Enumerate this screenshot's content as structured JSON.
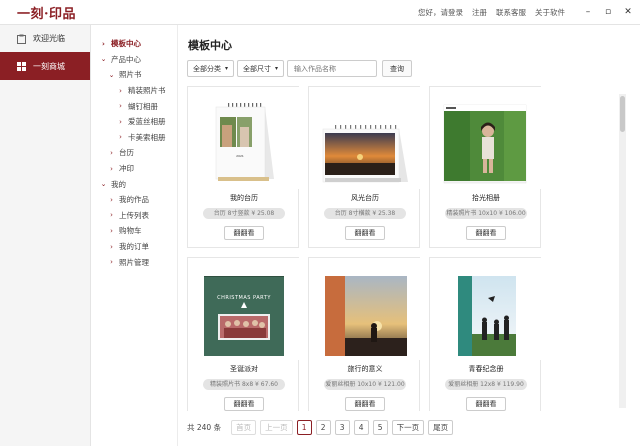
{
  "app": {
    "logo_text": "一刻·印品",
    "brand_color": "#8b1f24"
  },
  "topbar": {
    "links": [
      "您好，请登录",
      "注册",
      "联系客服",
      "关于软件"
    ],
    "window_controls": [
      "minimize-icon",
      "maximize-icon",
      "close-icon"
    ]
  },
  "leftnav": {
    "items": [
      {
        "label": "欢迎光临",
        "icon": "clipboard-icon",
        "active": false
      },
      {
        "label": "一刻商城",
        "icon": "grid-icon",
        "active": true
      }
    ]
  },
  "tree": {
    "nodes": [
      {
        "label": "模板中心",
        "level": 0,
        "arrow": "›",
        "active": true
      },
      {
        "label": "产品中心",
        "level": 0,
        "arrow": "⌄",
        "active": false
      },
      {
        "label": "照片书",
        "level": 1,
        "arrow": "⌄",
        "active": false
      },
      {
        "label": "精装照片书",
        "level": 2,
        "arrow": "›",
        "active": false
      },
      {
        "label": "蝴钉相册",
        "level": 2,
        "arrow": "›",
        "active": false
      },
      {
        "label": "爱蓝丝相册",
        "level": 2,
        "arrow": "›",
        "active": false
      },
      {
        "label": "卡美索相册",
        "level": 2,
        "arrow": "›",
        "active": false
      },
      {
        "label": "台历",
        "level": 1,
        "arrow": "›",
        "active": false
      },
      {
        "label": "冲印",
        "level": 1,
        "arrow": "›",
        "active": false
      },
      {
        "label": "我的",
        "level": 0,
        "arrow": "⌄",
        "active": false
      },
      {
        "label": "我的作品",
        "level": 1,
        "arrow": "›",
        "active": false
      },
      {
        "label": "上传列表",
        "level": 1,
        "arrow": "›",
        "active": false
      },
      {
        "label": "购物车",
        "level": 1,
        "arrow": "›",
        "active": false
      },
      {
        "label": "我的订单",
        "level": 1,
        "arrow": "›",
        "active": false
      },
      {
        "label": "照片管理",
        "level": 1,
        "arrow": "›",
        "active": false
      }
    ]
  },
  "main": {
    "title": "模板中心",
    "filters": {
      "category": "全部分类",
      "size": "全部尺寸",
      "search_placeholder": "输入作品名称",
      "search_button": "查询"
    },
    "cards": [
      {
        "name": "我的台历",
        "info": "台历 8寸竖款 ¥ 25.08",
        "button": "翻翻看",
        "thumb": "calendar-portrait"
      },
      {
        "name": "风光台历",
        "info": "台历 8寸横款 ¥ 25.38",
        "button": "翻翻看",
        "thumb": "calendar-landscape"
      },
      {
        "name": "拾光相册",
        "info": "精装照片书 10x10 ¥ 106.00",
        "button": "翻翻看",
        "thumb": "photobook-girl"
      },
      {
        "name": "圣诞派对",
        "info": "精装照片书 8x8 ¥ 67.60",
        "button": "翻翻看",
        "thumb": "christmas-party",
        "cover_text": "CHRISTMAS PARTY"
      },
      {
        "name": "旅行的意义",
        "info": "爱丽丝相册 10x10 ¥ 121.00",
        "button": "翻翻看",
        "thumb": "travel-sunset"
      },
      {
        "name": "青春纪念册",
        "info": "爱丽丝相册 12x8 ¥ 119.90",
        "button": "翻翻看",
        "thumb": "graduation"
      }
    ]
  },
  "pager": {
    "total": "共 240 条",
    "first": "首页",
    "prev": "上一页",
    "pages": [
      "1",
      "2",
      "3",
      "4",
      "5"
    ],
    "current": "1",
    "next": "下一页",
    "last": "尾页"
  }
}
